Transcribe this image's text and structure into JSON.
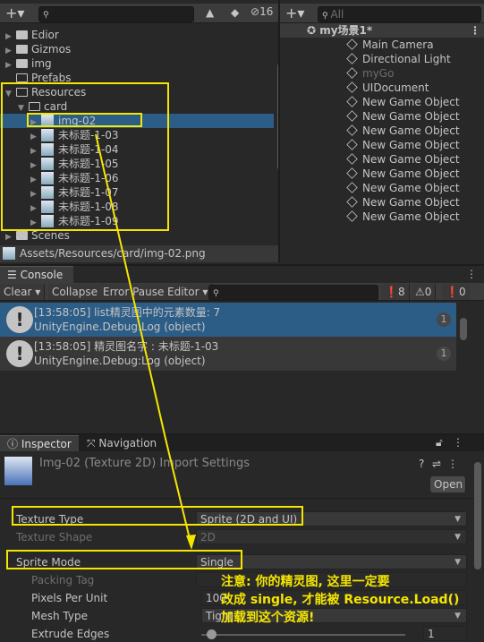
{
  "project": {
    "hidden_count": "16",
    "tree": [
      {
        "label": "Edior",
        "type": "folder",
        "indent": 1
      },
      {
        "label": "Gizmos",
        "type": "folder",
        "indent": 1
      },
      {
        "label": "img",
        "type": "folder",
        "indent": 1
      },
      {
        "label": "Prefabs",
        "type": "folder-empty",
        "indent": 1
      },
      {
        "label": "Resources",
        "type": "folder-open",
        "indent": 1
      },
      {
        "label": "card",
        "type": "folder-open",
        "indent": 2
      },
      {
        "label": "img-02",
        "type": "sprite",
        "indent": 3,
        "selected": true
      },
      {
        "label": "未标题-1-03",
        "type": "sprite",
        "indent": 3
      },
      {
        "label": "未标题-1-04",
        "type": "sprite",
        "indent": 3
      },
      {
        "label": "未标题-1-05",
        "type": "sprite",
        "indent": 3
      },
      {
        "label": "未标题-1-06",
        "type": "sprite",
        "indent": 3
      },
      {
        "label": "未标题-1-07",
        "type": "sprite",
        "indent": 3
      },
      {
        "label": "未标题-1-08",
        "type": "sprite",
        "indent": 3
      },
      {
        "label": "未标题-1-09",
        "type": "sprite",
        "indent": 3
      },
      {
        "label": "Scenes",
        "type": "folder",
        "indent": 1
      }
    ],
    "path": "Assets/Resources/card/img-02.png"
  },
  "hierarchy": {
    "search_placeholder": "All",
    "scene": "my场景1*",
    "objects": [
      {
        "label": "Main Camera"
      },
      {
        "label": "Directional Light"
      },
      {
        "label": "myGo",
        "inactive": true
      },
      {
        "label": "UIDocument"
      },
      {
        "label": "New Game Object"
      },
      {
        "label": "New Game Object"
      },
      {
        "label": "New Game Object"
      },
      {
        "label": "New Game Object"
      },
      {
        "label": "New Game Object"
      },
      {
        "label": "New Game Object"
      },
      {
        "label": "New Game Object"
      },
      {
        "label": "New Game Object"
      },
      {
        "label": "New Game Object"
      }
    ]
  },
  "console": {
    "tab": "Console",
    "clear": "Clear",
    "collapse": "Collapse",
    "error_pause": "Error Pause",
    "editor": "Editor",
    "log_count": "8",
    "warn_count": "0",
    "error_count": "0",
    "entries": [
      {
        "line1": "[13:58:05] list精灵图中的元素数量: 7",
        "line2": "UnityEngine.Debug:Log (object)",
        "count": "1",
        "selected": true
      },
      {
        "line1": "[13:58:05] 精灵图名字 : 未标题-1-03",
        "line2": "UnityEngine.Debug:Log (object)",
        "count": "1"
      }
    ]
  },
  "inspector": {
    "tab": "Inspector",
    "nav_tab": "Navigation",
    "title": "Img-02 (Texture 2D) Import Settings",
    "open": "Open",
    "fields": {
      "texture_type": {
        "label": "Texture Type",
        "value": "Sprite (2D and UI)"
      },
      "texture_shape": {
        "label": "Texture Shape",
        "value": "2D"
      },
      "sprite_mode": {
        "label": "Sprite Mode",
        "value": "Single"
      },
      "packing_tag": {
        "label": "Packing Tag",
        "value": ""
      },
      "ppu": {
        "label": "Pixels Per Unit",
        "value": "100"
      },
      "mesh_type": {
        "label": "Mesh Type",
        "value": "Tight"
      },
      "extrude": {
        "label": "Extrude Edges",
        "value": "1"
      }
    }
  },
  "annotation": {
    "lines": [
      "注意: 你的精灵图, 这里一定要",
      "改成 single, 才能被 Resource.Load()",
      "加载到这个资源!"
    ],
    "color": "#f5e600"
  }
}
